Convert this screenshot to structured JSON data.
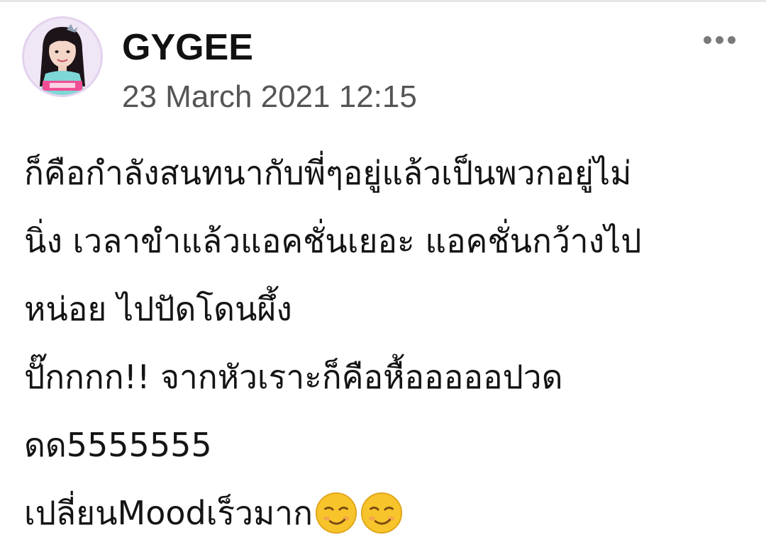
{
  "post": {
    "author": "GYGEE",
    "timestamp": "23 March 2021 12:15",
    "lines": [
      "ก็คือกำลังสนทนากับพี่ๆอยู่แล้วเป็นพวกอยู่ไม่",
      "นิ่ง เวลาขำแล้วแอคชั่นเยอะ แอคชั่นกว้างไป",
      "หน่อย ไปปัดโดนผึ้ง",
      "ปั๊กกกก!! จากหัวเราะก็คือหื้อออออปวด",
      "ดด5555555",
      "เปลี่ยนMoodเร็วมาก"
    ],
    "trailing_emojis": [
      "smirking-face-emoji",
      "smirking-face-emoji"
    ]
  },
  "icons": {
    "more": "more-dots-icon",
    "avatar": "profile-avatar"
  },
  "colors": {
    "text": "#141414",
    "muted": "#555555",
    "icon": "#7a7a7a",
    "emoji": "#f7c52b"
  }
}
